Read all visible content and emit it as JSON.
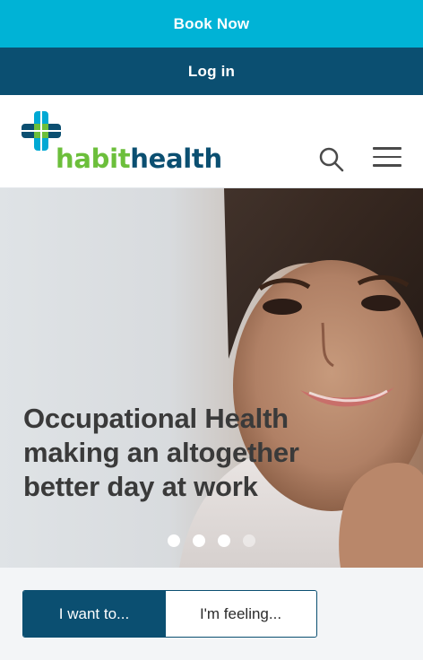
{
  "top_bar": {
    "book_label": "Book Now",
    "login_label": "Log in"
  },
  "header": {
    "logo": {
      "part1": "habit",
      "part2": "health"
    },
    "search_icon": "search-icon",
    "menu_icon": "hamburger-menu-icon"
  },
  "hero": {
    "title_line1": "Occupational Health",
    "title_line2": "making an altogether",
    "title_line3": "better day at work",
    "slides": {
      "count": 4,
      "active": [
        1,
        2,
        3
      ],
      "inactive": [
        4
      ]
    }
  },
  "tabs": {
    "want_label": "I want to...",
    "feeling_label": "I'm feeling..."
  },
  "colors": {
    "book_bar": "#00b3d6",
    "login_bar": "#0b4f71",
    "brand_green": "#6cbf3b",
    "brand_navy": "#0b4f71"
  }
}
